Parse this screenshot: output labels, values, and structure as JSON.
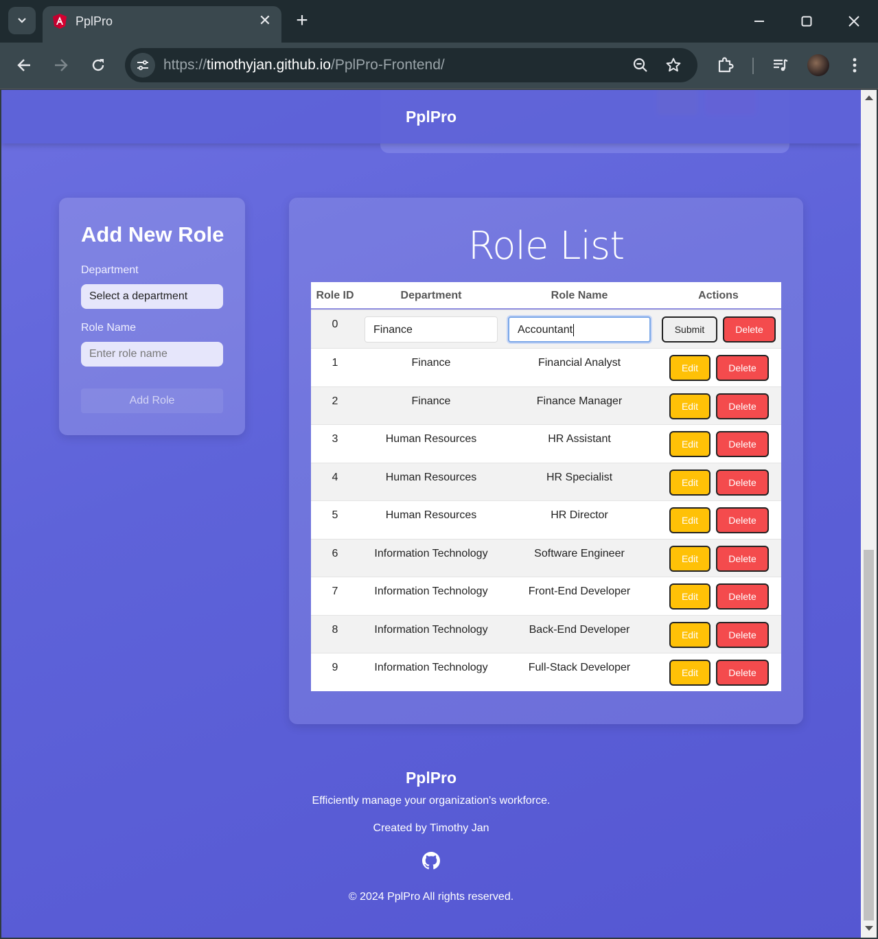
{
  "browser": {
    "tab_title": "PplPro",
    "url_scheme": "https://",
    "url_host": "timothyjan.github.io",
    "url_path": "/PplPro-Frontend/"
  },
  "header": {
    "brand": "PplPro"
  },
  "add_role": {
    "title": "Add New Role",
    "department_label": "Department",
    "department_selected": "Select a department",
    "role_name_label": "Role Name",
    "role_name_placeholder": "Enter role name",
    "add_button": "Add Role"
  },
  "role_list": {
    "title": "Role List",
    "columns": [
      "Role ID",
      "Department",
      "Role Name",
      "Actions"
    ],
    "editing_row": {
      "id": "0",
      "department_value": "Finance",
      "role_name_value": "Accountant",
      "submit_label": "Submit",
      "delete_label": "Delete"
    },
    "edit_label": "Edit",
    "delete_label": "Delete",
    "rows": [
      {
        "id": "1",
        "department": "Finance",
        "role": "Financial Analyst"
      },
      {
        "id": "2",
        "department": "Finance",
        "role": "Finance Manager"
      },
      {
        "id": "3",
        "department": "Human Resources",
        "role": "HR Assistant"
      },
      {
        "id": "4",
        "department": "Human Resources",
        "role": "HR Specialist"
      },
      {
        "id": "5",
        "department": "Human Resources",
        "role": "HR Director"
      },
      {
        "id": "6",
        "department": "Information Technology",
        "role": "Software Engineer"
      },
      {
        "id": "7",
        "department": "Information Technology",
        "role": "Front-End Developer"
      },
      {
        "id": "8",
        "department": "Information Technology",
        "role": "Back-End Developer"
      },
      {
        "id": "9",
        "department": "Information Technology",
        "role": "Full-Stack Developer"
      }
    ]
  },
  "footer": {
    "brand": "PplPro",
    "tagline": "Efficiently manage your organization's workforce.",
    "created_by": "Created by Timothy Jan",
    "github_icon": "github-icon",
    "copyright": "© 2024 PplPro All rights reserved."
  },
  "colors": {
    "page_gradient_start": "#6c6fe0",
    "page_gradient_end": "#5557d2",
    "edit_button": "#ffc107",
    "delete_button": "#f44b4d"
  }
}
